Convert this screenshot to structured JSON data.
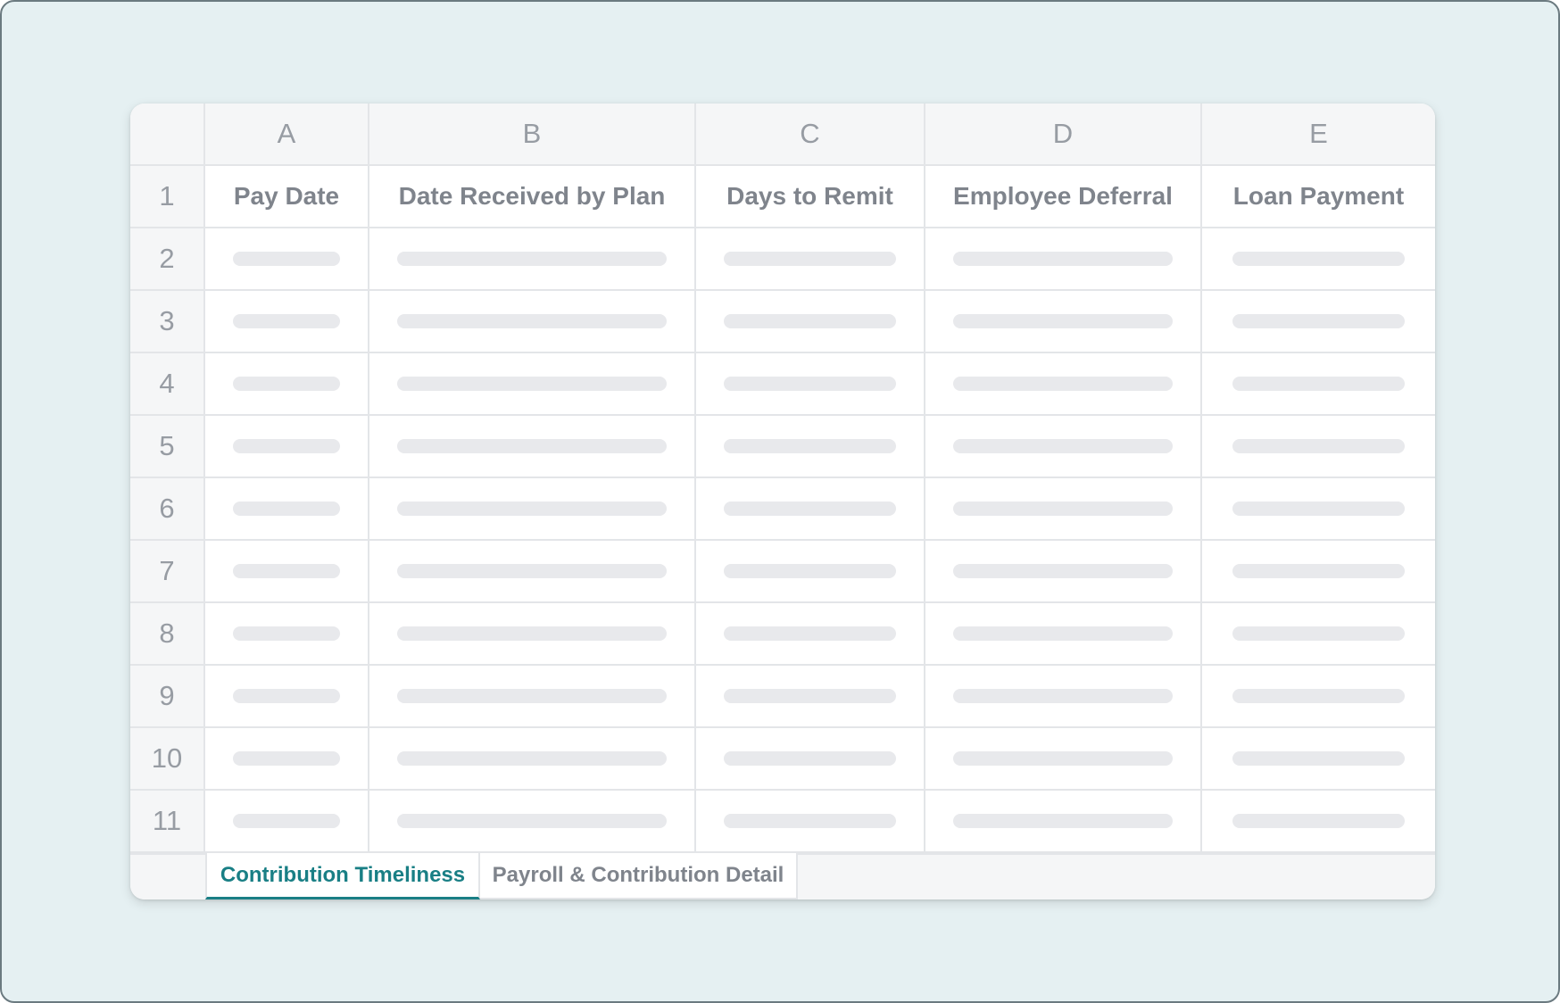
{
  "spreadsheet": {
    "columns": [
      "A",
      "B",
      "C",
      "D",
      "E"
    ],
    "headers": [
      "Pay Date",
      "Date Received by Plan",
      "Days to Remit",
      "Employee Deferral",
      "Loan Payment"
    ],
    "row_numbers": [
      "1",
      "2",
      "3",
      "4",
      "5",
      "6",
      "7",
      "8",
      "9",
      "10",
      "11"
    ]
  },
  "tabs": [
    {
      "label": "Contribution Timeliness",
      "active": true
    },
    {
      "label": "Payroll & Contribution Detail",
      "active": false
    }
  ],
  "colors": {
    "background": "#e5f0f2",
    "accent": "#197f85",
    "header_fill": "#f5f6f7",
    "gridline": "#e3e5e8",
    "placeholder": "#e8e9ec"
  }
}
